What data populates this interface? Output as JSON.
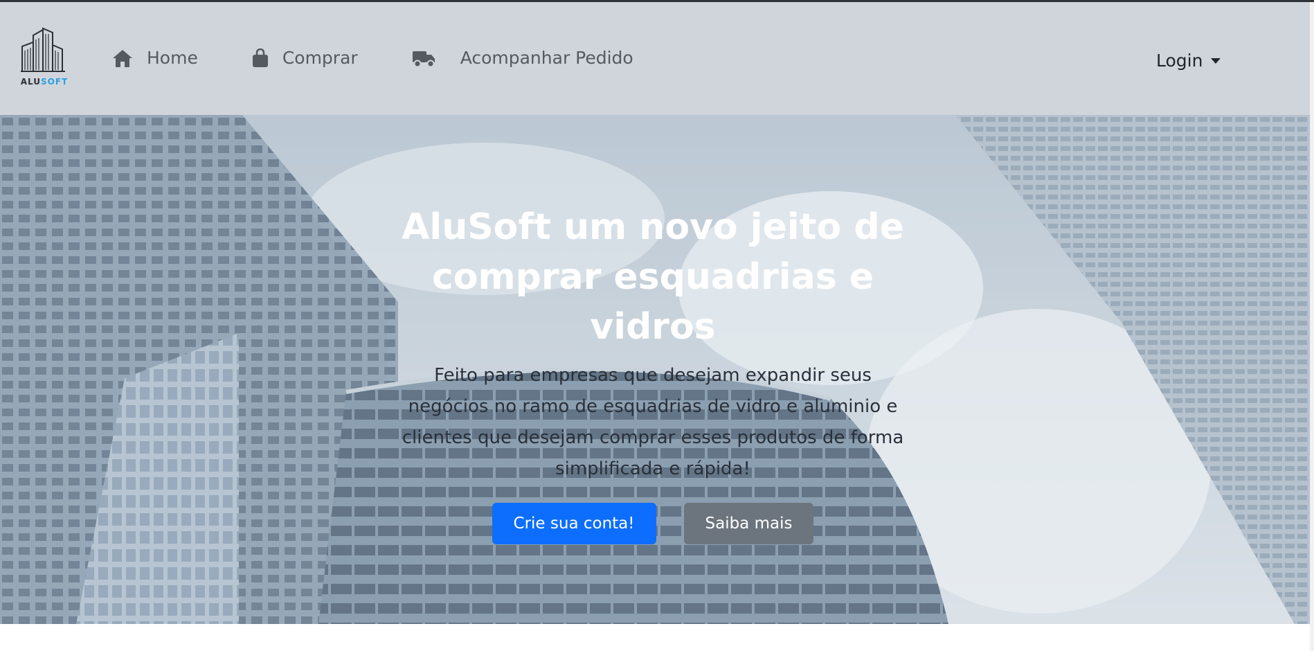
{
  "brand": {
    "logo_icon": "building-logo-icon",
    "name_part1": "ALU",
    "name_part2": "SOFT",
    "accent_color": "#2b9ee4"
  },
  "nav": {
    "links": [
      {
        "label": "Home",
        "icon": "home-icon"
      },
      {
        "label": "Comprar",
        "icon": "shopping-bag-icon"
      },
      {
        "label": "Acompanhar Pedido",
        "icon": "truck-icon"
      }
    ],
    "login": {
      "label": "Login",
      "icon": "caret-down-icon"
    }
  },
  "hero": {
    "background_icon": "city-buildings-image",
    "title": "AluSoft um novo jeito de comprar esquadrias e vidros",
    "text": "Feito para empresas que desejam expandir seus negócios no ramo de esquadrias de vidro e aluminio e clientes que desejam comprar esses produtos de forma simplificada e rápida!",
    "primary_button": "Crie sua conta!",
    "secondary_button": "Saiba mais"
  },
  "colors": {
    "navbar_bg": "#d0d5dc",
    "primary": "#0d6efd",
    "secondary": "#6c757d",
    "hero_title": "#ffffff"
  }
}
